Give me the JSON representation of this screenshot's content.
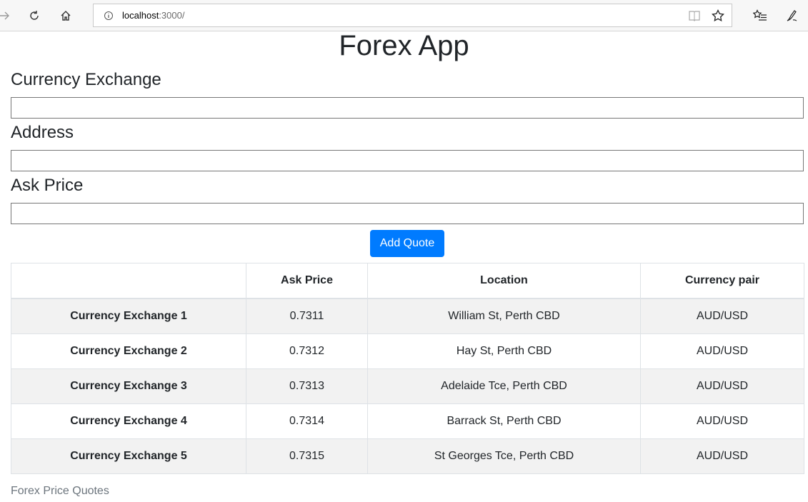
{
  "browser": {
    "url_host": "localhost",
    "url_rest": ":3000/"
  },
  "page": {
    "title": "Forex App"
  },
  "form": {
    "exchange_label": "Currency Exchange",
    "exchange_value": "",
    "address_label": "Address",
    "address_value": "",
    "ask_label": "Ask Price",
    "ask_value": "",
    "submit_label": "Add Quote"
  },
  "table": {
    "headers": [
      "",
      "Ask Price",
      "Location",
      "Currency pair"
    ],
    "rows": [
      {
        "name": "Currency Exchange 1",
        "ask": "0.7311",
        "location": "William St, Perth CBD",
        "pair": "AUD/USD"
      },
      {
        "name": "Currency Exchange 2",
        "ask": "0.7312",
        "location": "Hay St, Perth CBD",
        "pair": "AUD/USD"
      },
      {
        "name": "Currency Exchange 3",
        "ask": "0.7313",
        "location": "Adelaide Tce, Perth CBD",
        "pair": "AUD/USD"
      },
      {
        "name": "Currency Exchange 4",
        "ask": "0.7314",
        "location": "Barrack St, Perth CBD",
        "pair": "AUD/USD"
      },
      {
        "name": "Currency Exchange 5",
        "ask": "0.7315",
        "location": "St Georges Tce, Perth CBD",
        "pair": "AUD/USD"
      }
    ]
  },
  "footer": {
    "text": "Forex Price Quotes"
  },
  "colors": {
    "primary": "#007bff",
    "stripe": "#f2f2f2",
    "muted": "#6c757d"
  }
}
